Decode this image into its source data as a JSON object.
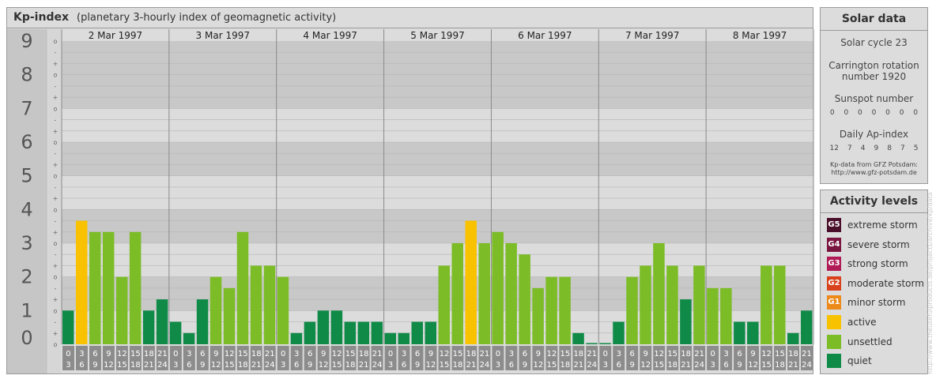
{
  "header": {
    "title": "Kp-index",
    "subtitle": "(planetary 3-hourly index of geomagnetic activity)"
  },
  "chart_data": {
    "type": "bar",
    "ylim": [
      0,
      9
    ],
    "y_tick_labels": [
      "0",
      "1",
      "2",
      "3",
      "4",
      "5",
      "6",
      "7",
      "8",
      "9"
    ],
    "sub_tick_labels": [
      "o",
      "+",
      "-"
    ],
    "days": [
      "2 Mar 1997",
      "3 Mar 1997",
      "4 Mar 1997",
      "5 Mar 1997",
      "6 Mar 1997",
      "7 Mar 1997",
      "8 Mar 1997"
    ],
    "interval_labels": [
      [
        "0",
        "3"
      ],
      [
        "3",
        "6"
      ],
      [
        "6",
        "9"
      ],
      [
        "9",
        "12"
      ],
      [
        "12",
        "15"
      ],
      [
        "15",
        "18"
      ],
      [
        "18",
        "21"
      ],
      [
        "21",
        "24"
      ]
    ],
    "values": [
      [
        1.0,
        3.667,
        3.333,
        3.333,
        2.0,
        3.333,
        1.0,
        1.333
      ],
      [
        0.667,
        0.333,
        1.333,
        2.0,
        1.667,
        3.333,
        2.333,
        2.333
      ],
      [
        2.0,
        0.333,
        0.667,
        1.0,
        1.0,
        0.667,
        0.667,
        0.667
      ],
      [
        0.333,
        0.333,
        0.667,
        0.667,
        2.333,
        3.0,
        3.667,
        3.0
      ],
      [
        3.333,
        3.0,
        2.667,
        1.667,
        2.0,
        2.0,
        0.333,
        0.0
      ],
      [
        0.0,
        0.667,
        2.0,
        2.333,
        3.0,
        2.333,
        1.333,
        2.333
      ],
      [
        1.667,
        1.667,
        0.667,
        0.667,
        2.333,
        2.333,
        0.333,
        1.0
      ]
    ]
  },
  "colors": {
    "quiet": "#0f8a47",
    "unsettled": "#7cbc26",
    "active": "#f8c200",
    "panel_bg": "#dcdcdc",
    "band_dark": "#c8c8c8",
    "band_light": "#dcdcdc",
    "axis_box": "#8c8c8c"
  },
  "solar": {
    "header": "Solar data",
    "cycle": "Solar cycle 23",
    "carrington_line1": "Carrington rotation",
    "carrington_line2": "number 1920",
    "sunspot_label": "Sunspot number",
    "sunspot_values": [
      "0",
      "0",
      "0",
      "0",
      "0",
      "0",
      "0"
    ],
    "ap_label": "Daily Ap-index",
    "ap_values": [
      "12",
      "7",
      "4",
      "9",
      "8",
      "7",
      "5"
    ],
    "source_line1": "Kp-data from GFZ Potsdam:",
    "source_line2": "http://www.gfz-potsdam.de"
  },
  "activity": {
    "header": "Activity levels",
    "levels": [
      {
        "badge": "G5",
        "label": "extreme storm",
        "color": "#4a0f2a"
      },
      {
        "badge": "G4",
        "label": "severe storm",
        "color": "#7a1540"
      },
      {
        "badge": "G3",
        "label": "strong storm",
        "color": "#b01a55"
      },
      {
        "badge": "G2",
        "label": "moderate storm",
        "color": "#d8431e"
      },
      {
        "badge": "G1",
        "label": "minor storm",
        "color": "#ec8a1a"
      },
      {
        "badge": "",
        "label": "active",
        "color": "#f8c200"
      },
      {
        "badge": "",
        "label": "unsettled",
        "color": "#7cbc26"
      },
      {
        "badge": "",
        "label": "quiet",
        "color": "#0f8a47"
      }
    ]
  },
  "watermark": "http://www.theusefulproducts.de/projects/archive/kp/data"
}
